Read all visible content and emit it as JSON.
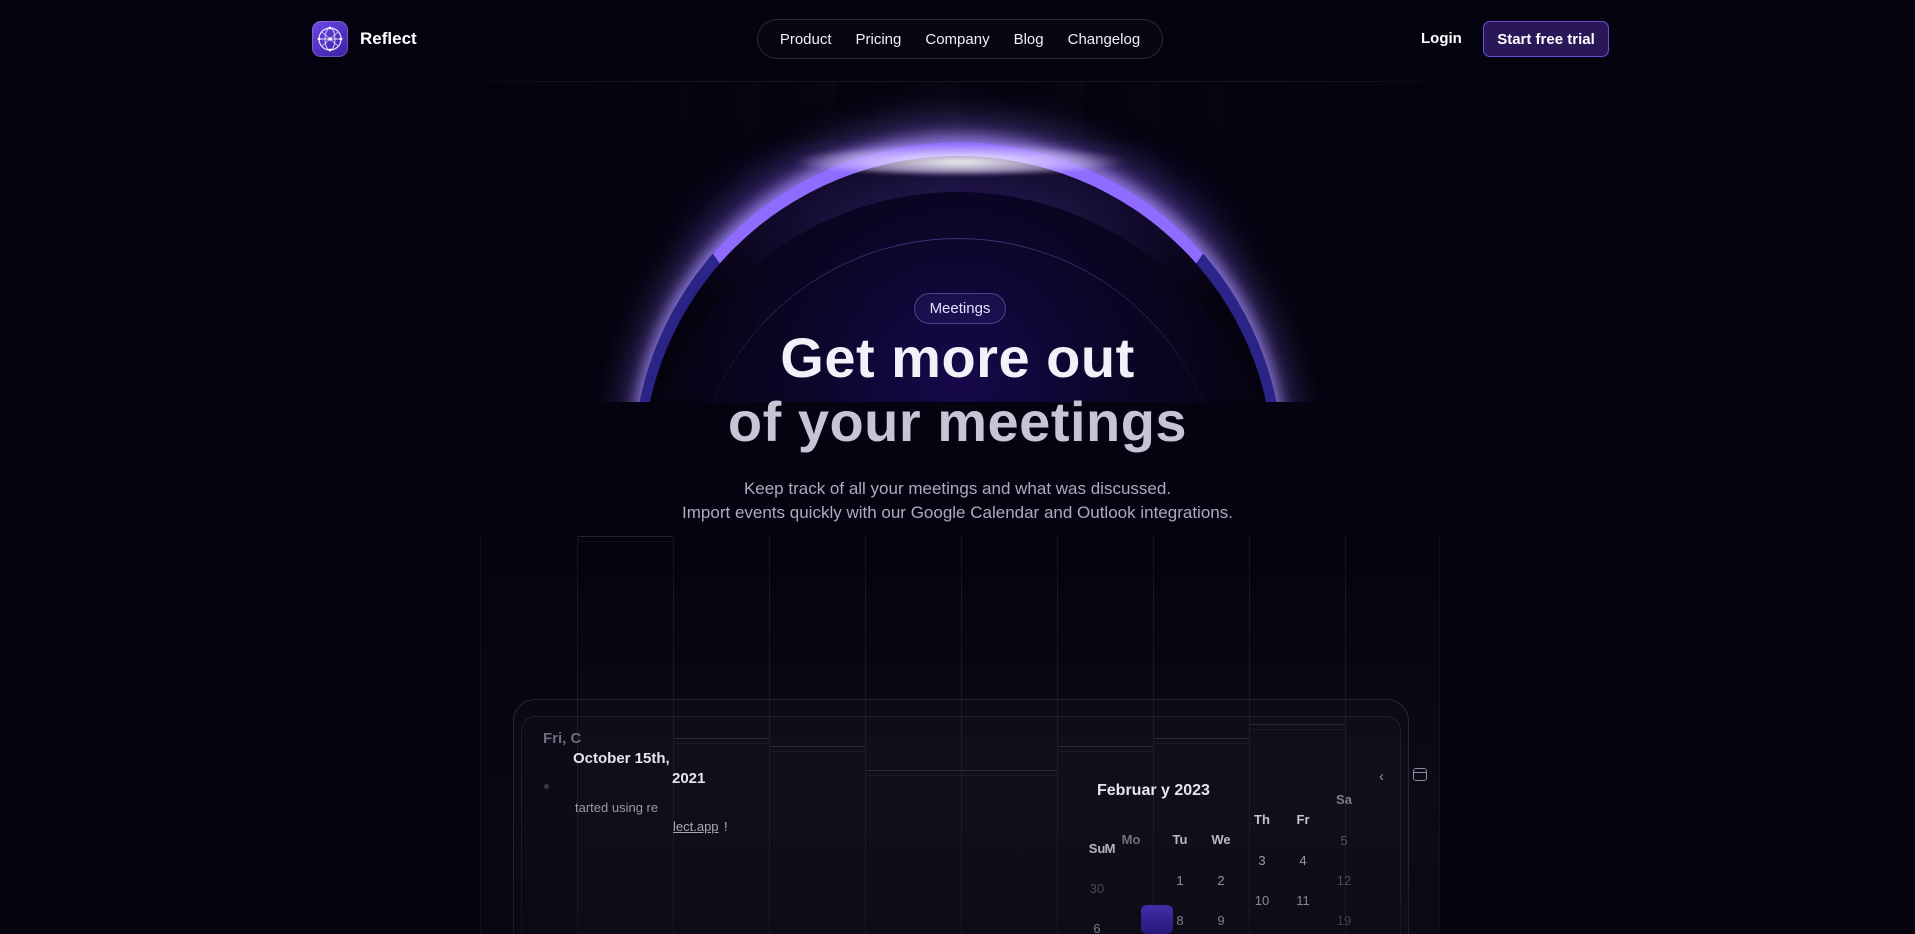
{
  "brand": {
    "name": "Reflect",
    "logo_icon": "globe-network-icon"
  },
  "nav": {
    "items": [
      {
        "label": "Product"
      },
      {
        "label": "Pricing"
      },
      {
        "label": "Company"
      },
      {
        "label": "Blog"
      },
      {
        "label": "Changelog"
      }
    ]
  },
  "header": {
    "login_label": "Login",
    "trial_label": "Start free trial"
  },
  "hero": {
    "badge": "Meetings",
    "title_line1": "Get more out",
    "title_line2": "of your meetings",
    "subtitle_line1": "Keep track of all your meetings and what was discussed.",
    "subtitle_line2": "Import events quickly with our Google Calendar and Outlook integrations."
  },
  "preview": {
    "note": {
      "date_faint": "Fri, C",
      "date": "October 15th,",
      "year": "2021",
      "text": "tarted using re",
      "link": "lect.app",
      "link_tail": "!"
    },
    "calendar": {
      "title": "Februar   y 2023",
      "day_headers": [
        "Su",
        "M",
        "Mo",
        "Tu",
        "We",
        "Th",
        "Fr",
        "Sa"
      ],
      "row1": [
        "30",
        "1",
        "2",
        "3",
        "4",
        "5"
      ],
      "row2": [
        "6",
        "8",
        "9",
        "10",
        "11",
        "12"
      ],
      "row3": [
        "19"
      ]
    }
  },
  "colors": {
    "accent": "#6b4dd6",
    "background": "#05030f",
    "glow": "#8f6cff"
  }
}
